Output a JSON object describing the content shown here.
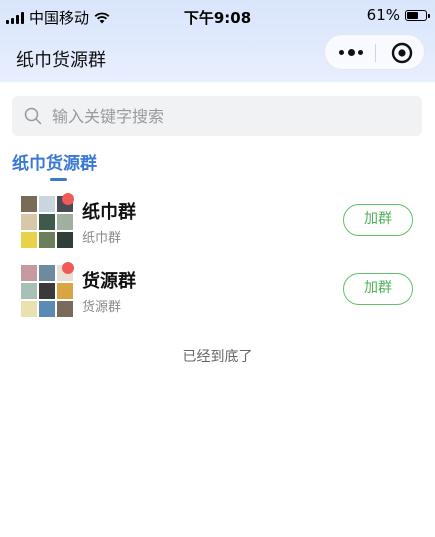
{
  "status_bar": {
    "carrier": "中国移动",
    "time": "下午9:08",
    "battery": "61%",
    "battery_level": 0.61
  },
  "header": {
    "title": "纸巾货源群",
    "more_icon": "more-dots-icon",
    "close_icon": "target-close-icon"
  },
  "search": {
    "placeholder": "输入关键字搜索",
    "value": ""
  },
  "tabs": [
    {
      "label": "纸巾货源群",
      "active": true
    }
  ],
  "groups": [
    {
      "name": "纸巾群",
      "subtitle": "纸巾群",
      "button": "加群",
      "unread_dot": true,
      "avatar_colors": [
        "#7a6a58",
        "#c9d6de",
        "#4b4b55",
        "#d8c7a8",
        "#3d5a4a",
        "#9fb0a0",
        "#e8d24a",
        "#6d7f5a",
        "#2f3e36"
      ]
    },
    {
      "name": "货源群",
      "subtitle": "货源群",
      "button": "加群",
      "unread_dot": true,
      "avatar_colors": [
        "#c59aa0",
        "#6f8a9e",
        "#e6e0d6",
        "#a8c0b6",
        "#3a3a3a",
        "#d9a441",
        "#e9e1b0",
        "#5b8ab5",
        "#7a6a5c"
      ]
    }
  ],
  "footer": "已经到底了",
  "colors": {
    "accent_blue": "#3a78d8",
    "join_green": "#4fb35a",
    "dot_red": "#f25a5a"
  }
}
